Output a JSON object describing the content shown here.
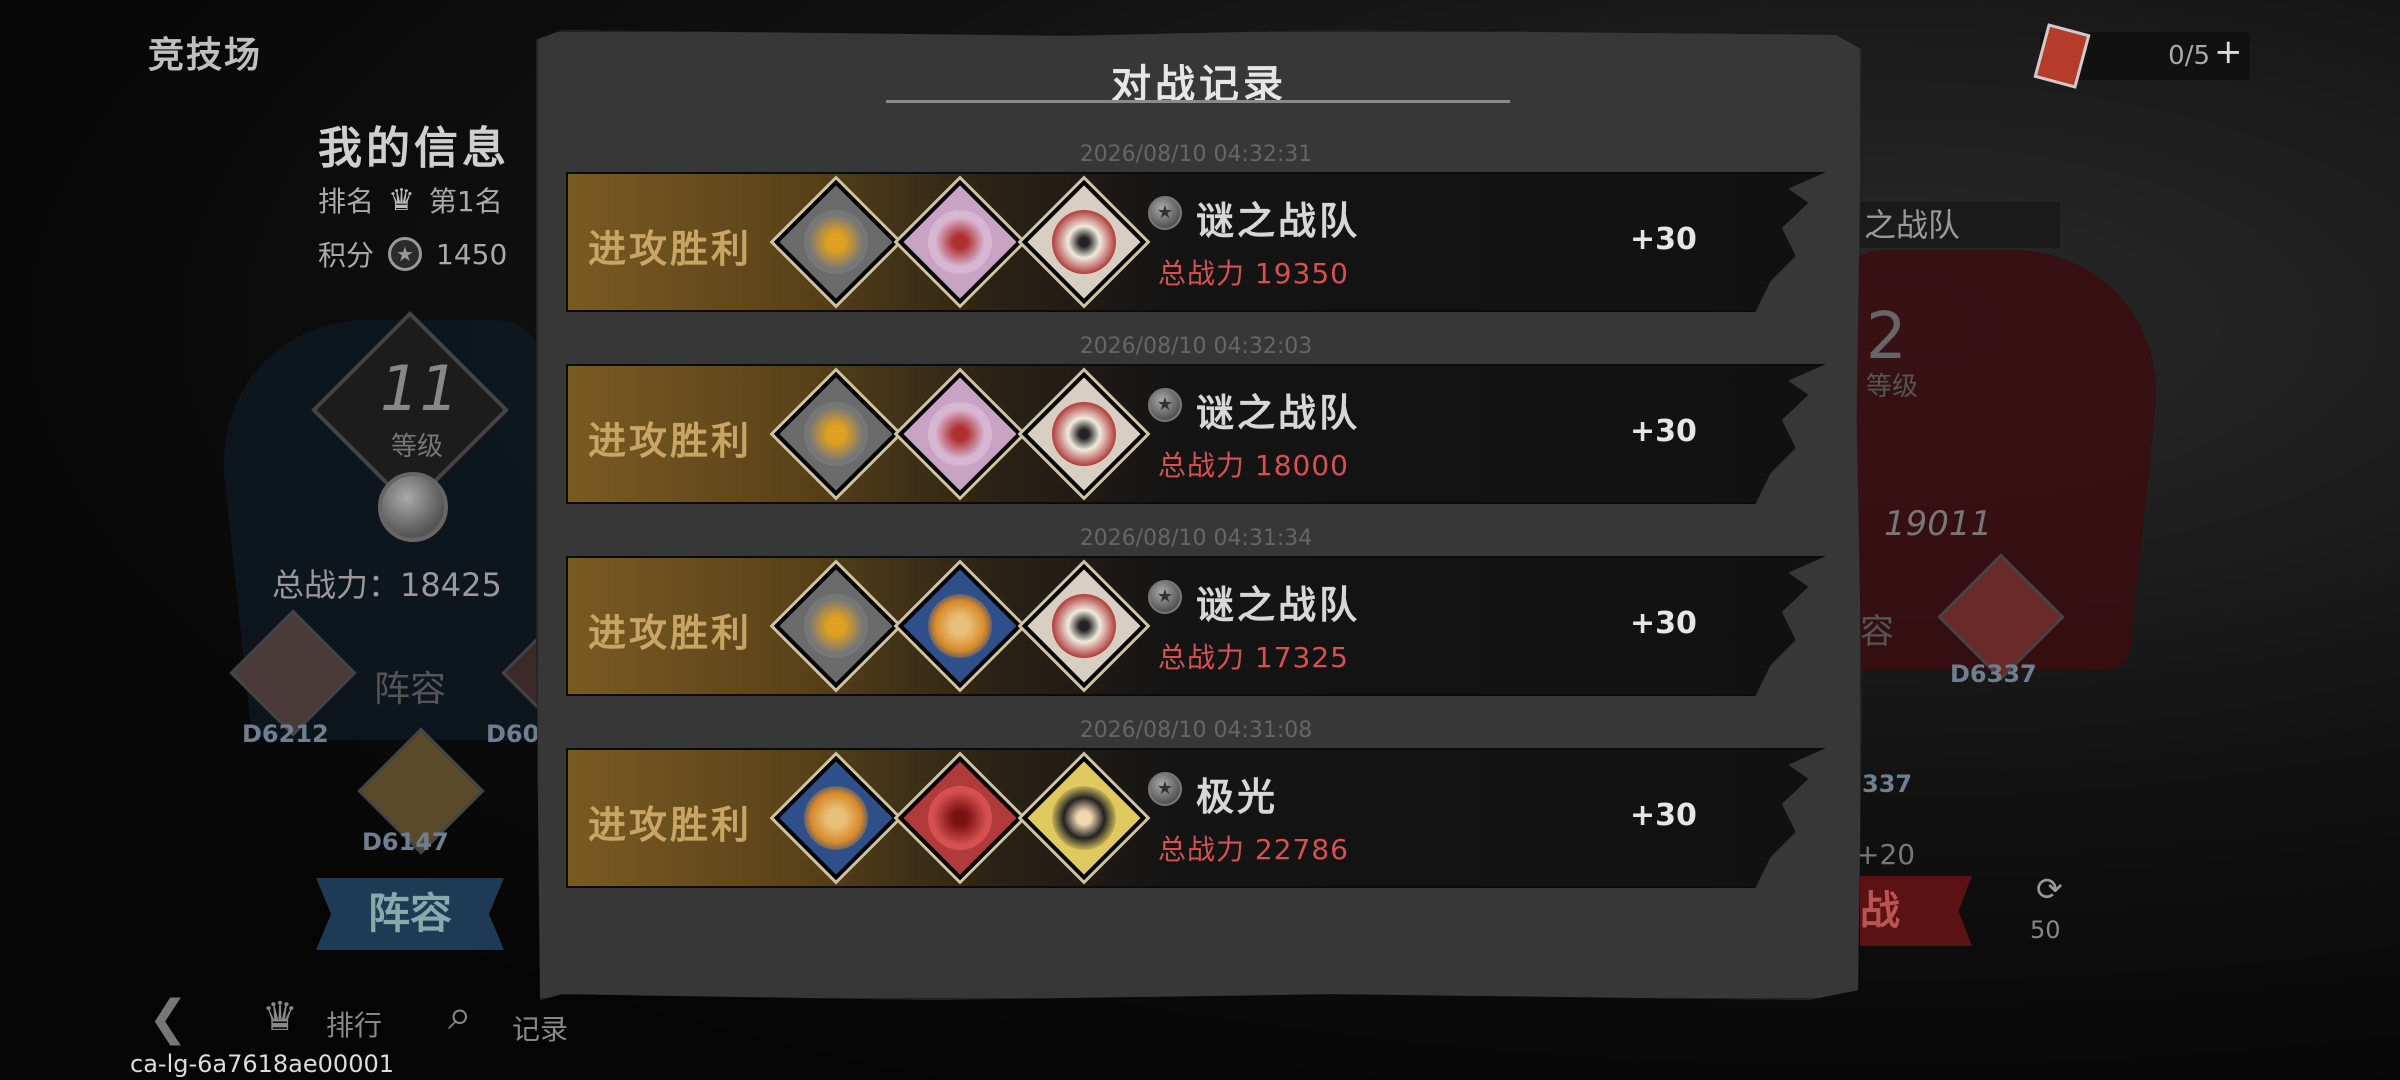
{
  "screen": {
    "arena_title": "竞技场",
    "my_info": {
      "title": "我的信息",
      "rank_label": "排名",
      "rank_value": "第1名",
      "score_label": "积分",
      "score_value": "1450",
      "level": "11",
      "level_label": "等级",
      "total_power": "总战力：18425",
      "lineup_text": "阵容",
      "lineup_button": "阵容",
      "hero_labels": [
        "D6212",
        "D60",
        "D6147"
      ]
    },
    "opponent": {
      "team_name": "之战队",
      "level": "2",
      "level_label": "等级",
      "total_power": "19011",
      "lineup_text": "容",
      "hero_labels": [
        "D6337",
        "337"
      ],
      "points": "+20",
      "fight_button": "战",
      "refresh_cost": "50"
    },
    "tickets": "0/5",
    "bottom_nav": {
      "back_icon": "back-arrow-icon",
      "rank_label": "排行",
      "record_label": "记录"
    },
    "device_id": "ca-lg-6a7618ae00001"
  },
  "modal": {
    "title": "对战记录",
    "records": [
      {
        "time": "2026/08/10 04:32:31",
        "result": "进攻胜利",
        "heroes": [
          "wolf-hero",
          "pink-bear-hero",
          "white-clown-hero"
        ],
        "team_name": "谜之战队",
        "power": "总战力 19350",
        "points": "+30"
      },
      {
        "time": "2026/08/10 04:32:03",
        "result": "进攻胜利",
        "heroes": [
          "wolf-hero",
          "pink-bear-hero",
          "white-clown-hero"
        ],
        "team_name": "谜之战队",
        "power": "总战力 18000",
        "points": "+30"
      },
      {
        "time": "2026/08/10 04:31:34",
        "result": "进攻胜利",
        "heroes": [
          "wolf-hero",
          "cowboy-hero",
          "white-clown-hero"
        ],
        "team_name": "谜之战队",
        "power": "总战力 17325",
        "points": "+30"
      },
      {
        "time": "2026/08/10 04:31:08",
        "result": "进攻胜利",
        "heroes": [
          "cowboy-hero",
          "red-blob-hero",
          "top-hat-hero"
        ],
        "team_name": "极光",
        "power": "总战力 22786",
        "points": "+30"
      }
    ]
  },
  "colors": {
    "win_gold": "#c6a565",
    "power_red": "#d85050",
    "modal_bg": "#373737"
  }
}
